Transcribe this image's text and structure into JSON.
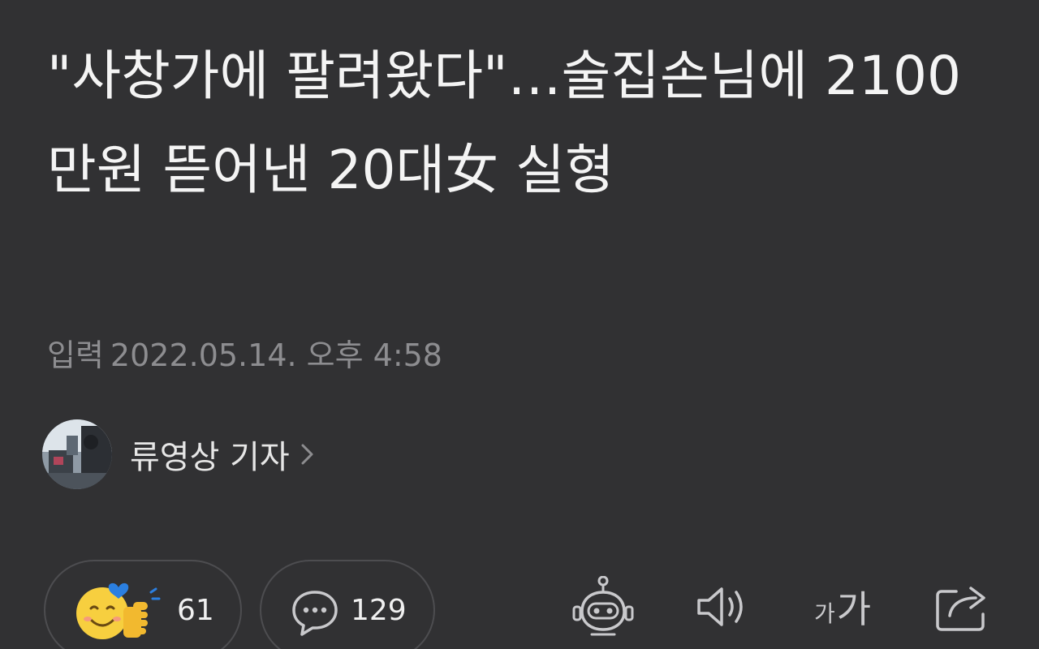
{
  "article": {
    "headline": "\"사창가에 팔려왔다\"…술집손님에 2100만원 뜯어낸 20대女 실형",
    "published_label": "입력",
    "published_time": "2022.05.14. 오후 4:58"
  },
  "author": {
    "name": "류영상 기자"
  },
  "actions": {
    "reaction_count": "61",
    "comment_count": "129"
  },
  "toolbar": {
    "font_small": "가",
    "font_large": "가",
    "icons": [
      "robot-icon",
      "speaker-icon",
      "font-size-icon",
      "share-icon"
    ]
  },
  "colors": {
    "background": "#313133",
    "headline": "#f4f4f4",
    "meta": "#8d8d90",
    "icon": "#c9c9cc",
    "emoji": "#f7cf3f",
    "emoji_heart": "#2b7fe0"
  }
}
